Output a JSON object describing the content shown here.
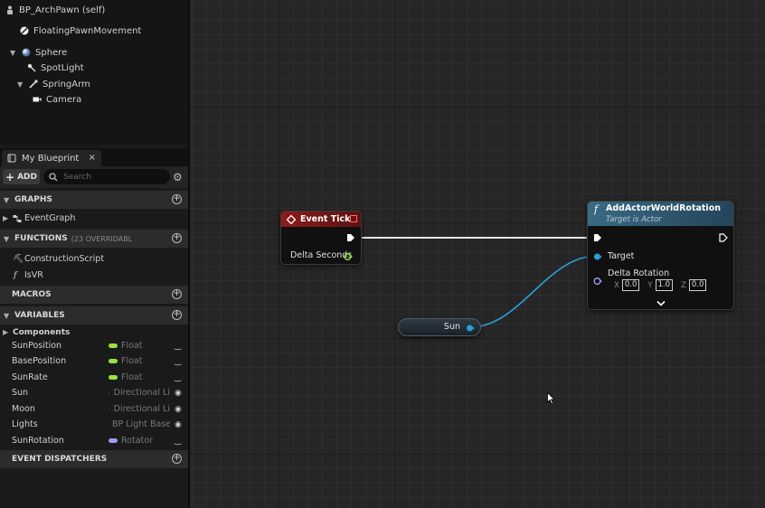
{
  "components": {
    "root": "BP_ArchPawn (self)",
    "items": [
      "FloatingPawnMovement",
      "Sphere",
      "SpotLight",
      "SpringArm",
      "Camera"
    ]
  },
  "my_blueprint": {
    "tab_label": "My Blueprint",
    "close_glyph": "×",
    "add_label": "ADD",
    "search_placeholder": "Search"
  },
  "sections": {
    "graphs": {
      "label": "GRAPHS",
      "items": [
        "EventGraph"
      ]
    },
    "functions": {
      "label": "FUNCTIONS",
      "sub": "(23 OVERRIDABL",
      "items": [
        "ConstructionScript",
        "IsVR"
      ]
    },
    "macros": {
      "label": "MACROS"
    },
    "variables": {
      "label": "VARIABLES",
      "category": "Components",
      "items": [
        {
          "name": "SunPosition",
          "type": "Float",
          "color": "#9be23e"
        },
        {
          "name": "BasePosition",
          "type": "Float",
          "color": "#9be23e"
        },
        {
          "name": "SunRate",
          "type": "Float",
          "color": "#9be23e"
        },
        {
          "name": "Sun",
          "type": "Directional Li",
          "color": "#33a6e0"
        },
        {
          "name": "Moon",
          "type": "Directional Li",
          "color": "#33a6e0"
        },
        {
          "name": "Lights",
          "type": "BP Light Base",
          "color": "#33a6e0"
        },
        {
          "name": "SunRotation",
          "type": "Rotator",
          "color": "#9a9ef0"
        }
      ]
    },
    "dispatchers": {
      "label": "EVENT DISPATCHERS"
    }
  },
  "graph": {
    "event_tick": {
      "title": "Event Tick",
      "pin": "Delta Seconds"
    },
    "add_rotation": {
      "title": "AddActorWorldRotation",
      "subtitle": "Target is Actor",
      "target_label": "Target",
      "delta_label": "Delta Rotation",
      "x_label": "X",
      "x_value": "0.0",
      "y_label": "Y",
      "y_value": "1.0",
      "z_label": "Z",
      "z_value": "0.0"
    },
    "sun_node": {
      "label": "Sun"
    }
  }
}
